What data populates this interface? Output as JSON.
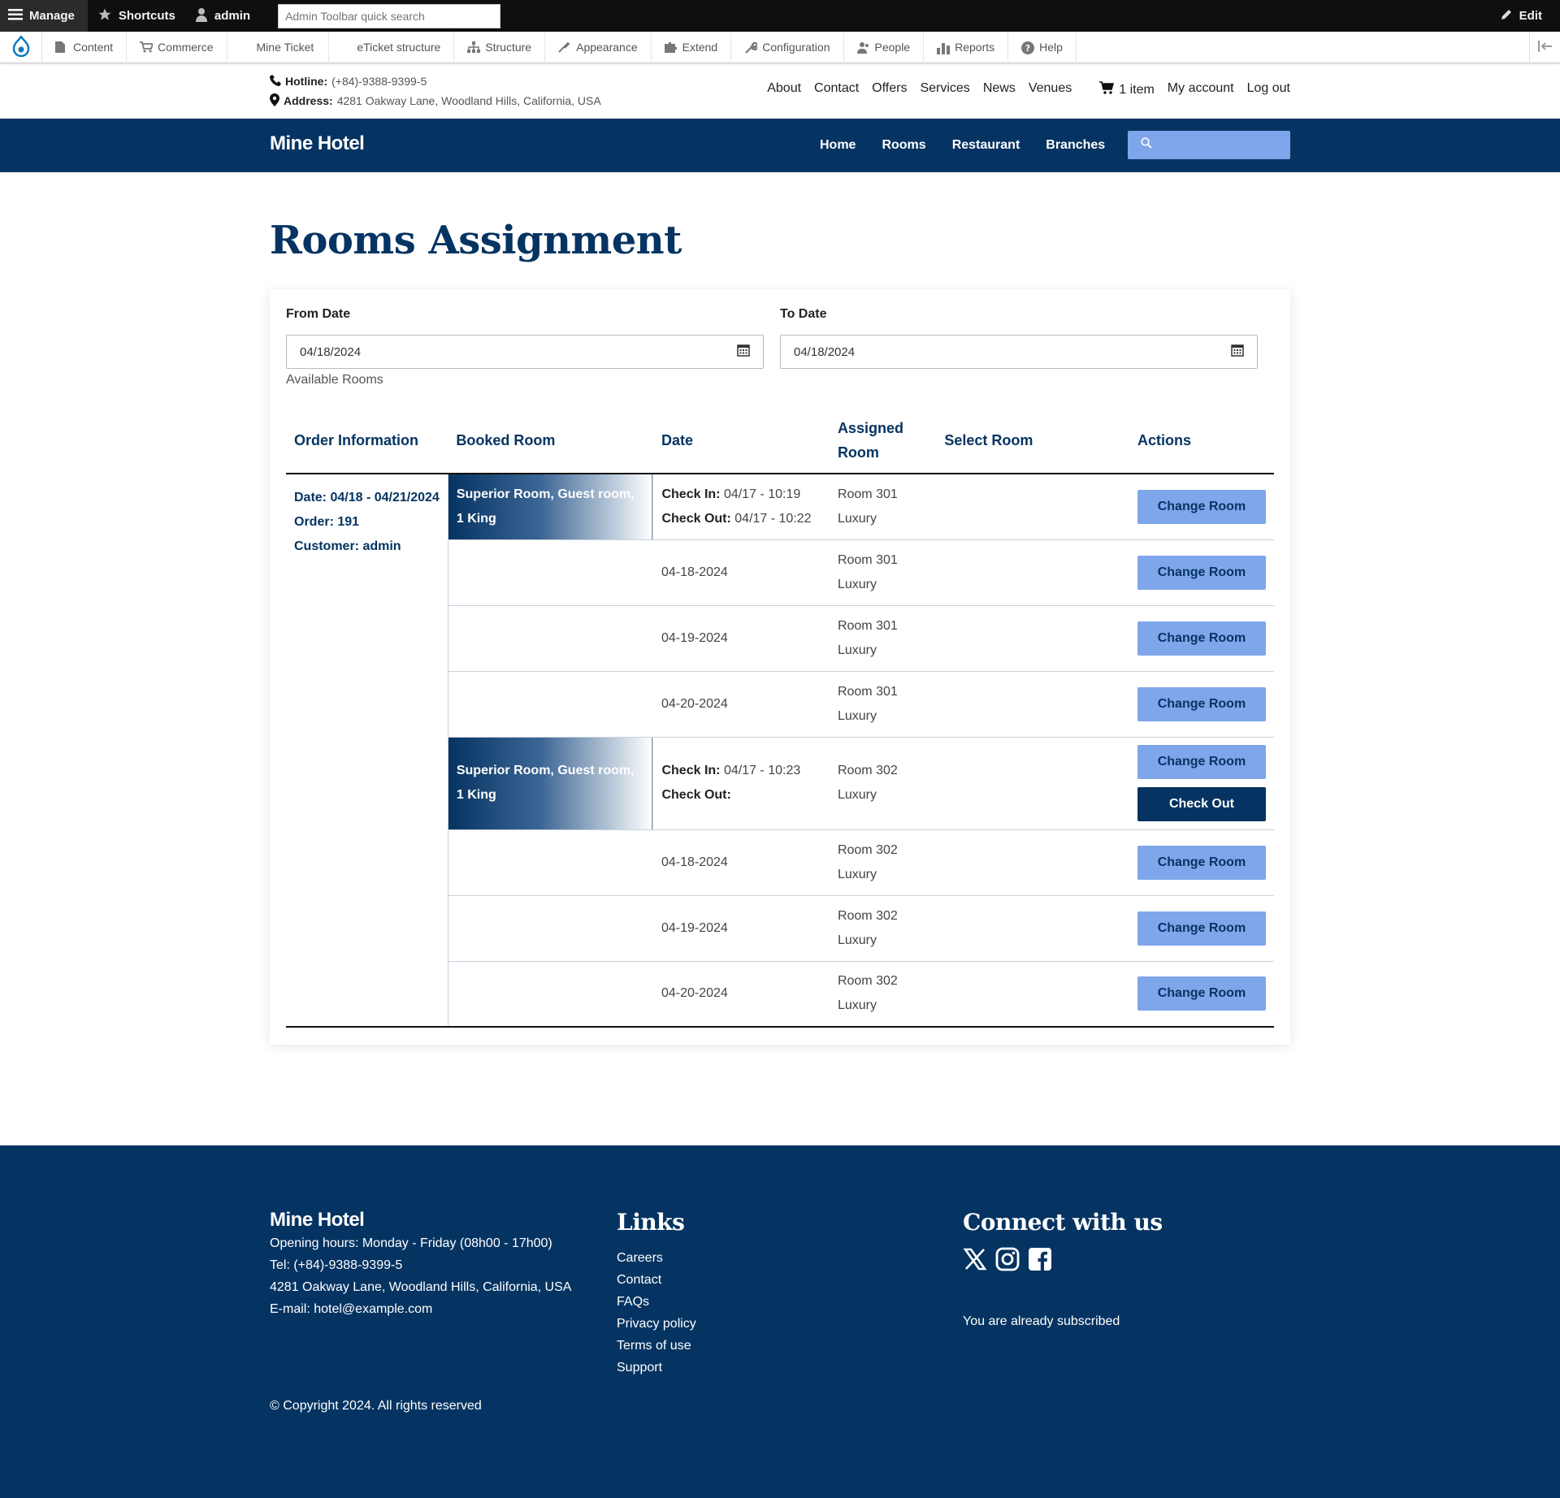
{
  "toolbar": {
    "manage": "Manage",
    "shortcuts": "Shortcuts",
    "user": "admin",
    "search_placeholder": "Admin Toolbar quick search",
    "edit": "Edit",
    "menu": [
      "Content",
      "Commerce",
      "Mine Ticket",
      "eTicket structure",
      "Structure",
      "Appearance",
      "Extend",
      "Configuration",
      "People",
      "Reports",
      "Help"
    ]
  },
  "info": {
    "hotline_label": "Hotline:",
    "hotline": "(+84)-9388-9399-5",
    "address_label": "Address:",
    "address": "4281 Oakway Lane, Woodland Hills, California, USA"
  },
  "topnav": {
    "links": [
      "About",
      "Contact",
      "Offers",
      "Services",
      "News",
      "Venues"
    ],
    "cart": "1 item",
    "account": "My account",
    "logout": "Log out"
  },
  "mainbar": {
    "brand": "Mine Hotel",
    "links": [
      "Home",
      "Rooms",
      "Restaurant",
      "Branches"
    ]
  },
  "page": {
    "title": "Rooms Assignment",
    "from_label": "From Date",
    "from_value": "04/18/2024",
    "to_label": "To Date",
    "to_value": "04/18/2024",
    "available": "Available Rooms"
  },
  "table": {
    "headers": [
      "Order Information",
      "Booked Room",
      "Date",
      "Assigned Room",
      "Select Room",
      "Actions"
    ],
    "order": {
      "date": "Date: 04/18 - 04/21/2024",
      "order": "Order: 191",
      "customer": "Customer: admin"
    },
    "checkin_label": "Check In:",
    "checkout_label": "Check Out:",
    "change_label": "Change Room",
    "checkout_button": "Check Out",
    "rooms": [
      {
        "name": "Superior Room, Guest room, 1 King",
        "check_in": "04/17 - 10:19",
        "check_out": "04/17 - 10:22",
        "assigned": "Room 301",
        "type": "Luxury",
        "dates": [
          {
            "date": "04-18-2024",
            "assigned": "Room 301",
            "type": "Luxury"
          },
          {
            "date": "04-19-2024",
            "assigned": "Room 301",
            "type": "Luxury"
          },
          {
            "date": "04-20-2024",
            "assigned": "Room 301",
            "type": "Luxury"
          }
        ]
      },
      {
        "name": "Superior Room, Guest room, 1 King",
        "check_in": "04/17 - 10:23",
        "check_out": "",
        "assigned": "Room 302",
        "type": "Luxury",
        "dates": [
          {
            "date": "04-18-2024",
            "assigned": "Room 302",
            "type": "Luxury"
          },
          {
            "date": "04-19-2024",
            "assigned": "Room 302",
            "type": "Luxury"
          },
          {
            "date": "04-20-2024",
            "assigned": "Room 302",
            "type": "Luxury"
          }
        ]
      }
    ]
  },
  "footer": {
    "brand": "Mine Hotel",
    "hours": "Opening hours: Monday - Friday (08h00 - 17h00)",
    "tel": "Tel: (+84)-9388-9399-5",
    "address": "4281 Oakway Lane, Woodland Hills, California, USA",
    "email": "E-mail: hotel@example.com",
    "links_title": "Links",
    "links": [
      "Careers",
      "Contact",
      "FAQs",
      "Privacy policy",
      "Terms of use",
      "Support"
    ],
    "connect_title": "Connect with us",
    "subscribed": "You are already subscribed",
    "copyright": "© Copyright 2024. All rights reserved"
  },
  "colors": {
    "primary": "#063462",
    "accent": "#7fa6ea"
  }
}
